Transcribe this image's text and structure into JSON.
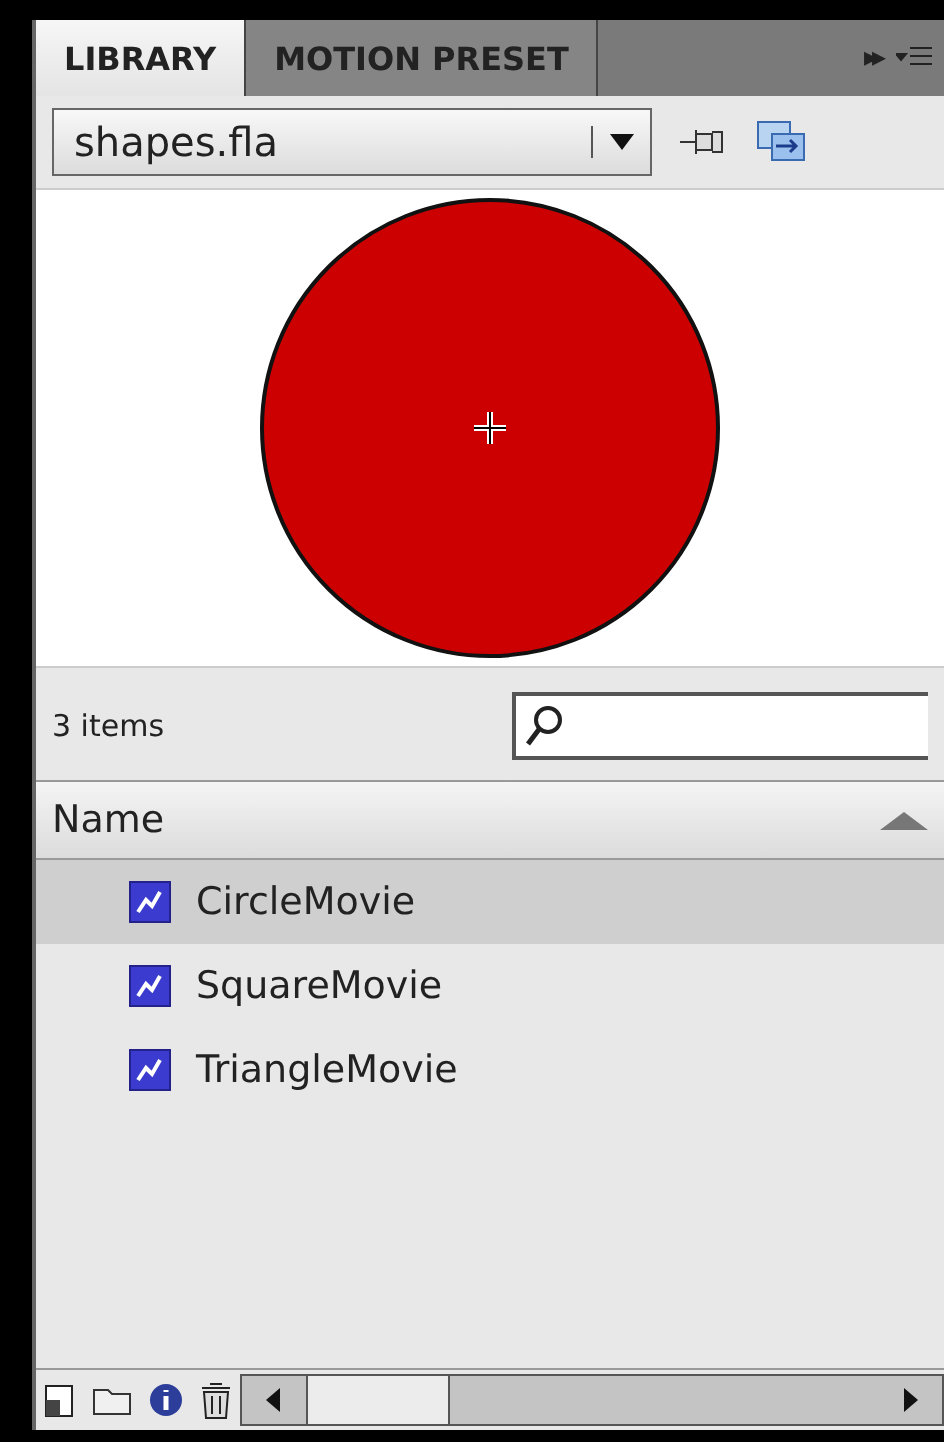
{
  "tabs": [
    {
      "label": "LIBRARY",
      "selected": true
    },
    {
      "label": "MOTION PRESET",
      "selected": false
    }
  ],
  "overflow_glyph": "▸▸",
  "document_select": {
    "value": "shapes.fla"
  },
  "item_count": "3 items",
  "table": {
    "columns": [
      {
        "label": "Name",
        "sorted_ascending": true
      }
    ],
    "rows": [
      {
        "name": "CircleMovie",
        "selected": true
      },
      {
        "name": "SquareMovie",
        "selected": false
      },
      {
        "name": "TriangleMovie",
        "selected": false
      }
    ]
  }
}
